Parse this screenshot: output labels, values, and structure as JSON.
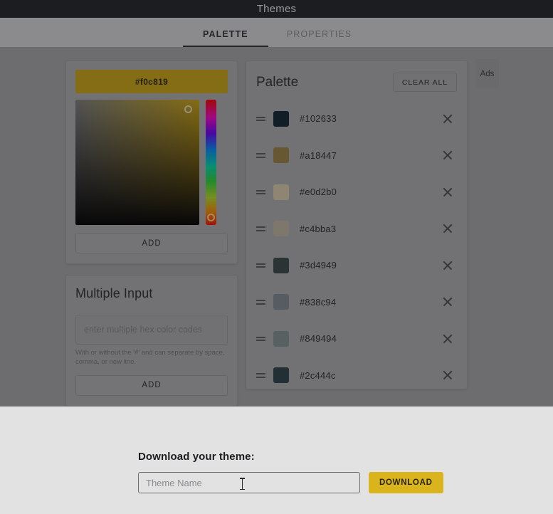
{
  "window": {
    "title": "Themes"
  },
  "tabs": [
    {
      "label": "PALETTE",
      "active": true
    },
    {
      "label": "PROPERTIES",
      "active": false
    }
  ],
  "picker": {
    "hex_value": "#f0c819",
    "swatch_color": "#f0c819",
    "add_label": "ADD",
    "handle_icon": "color-picker-handle-icon",
    "hue_handle_icon": "hue-slider-handle-icon"
  },
  "multiple_input": {
    "title": "Multiple Input",
    "placeholder": "enter multiple hex color codes",
    "value": "",
    "hint": "With or without the '#' and can separate by space, comma, or new line.",
    "add_label": "ADD"
  },
  "palette": {
    "title": "Palette",
    "clear_all_label": "CLEAR ALL",
    "drag_icon": "drag-handle-icon",
    "remove_icon": "close-icon",
    "items": [
      {
        "hex": "#102633",
        "color": "#102633"
      },
      {
        "hex": "#a18447",
        "color": "#a18447"
      },
      {
        "hex": "#e0d2b0",
        "color": "#e0d2b0"
      },
      {
        "hex": "#c4bba3",
        "color": "#c4bba3"
      },
      {
        "hex": "#3d4949",
        "color": "#3d4949"
      },
      {
        "hex": "#838c94",
        "color": "#838c94"
      },
      {
        "hex": "#849494",
        "color": "#849494"
      },
      {
        "hex": "#2c444c",
        "color": "#2c444c"
      }
    ]
  },
  "ads": {
    "label": "Ads"
  },
  "download_modal": {
    "title": "Download your theme:",
    "input_placeholder": "Theme Name",
    "input_value": "",
    "button_label": "DOWNLOAD",
    "button_color": "#d9b41d"
  }
}
